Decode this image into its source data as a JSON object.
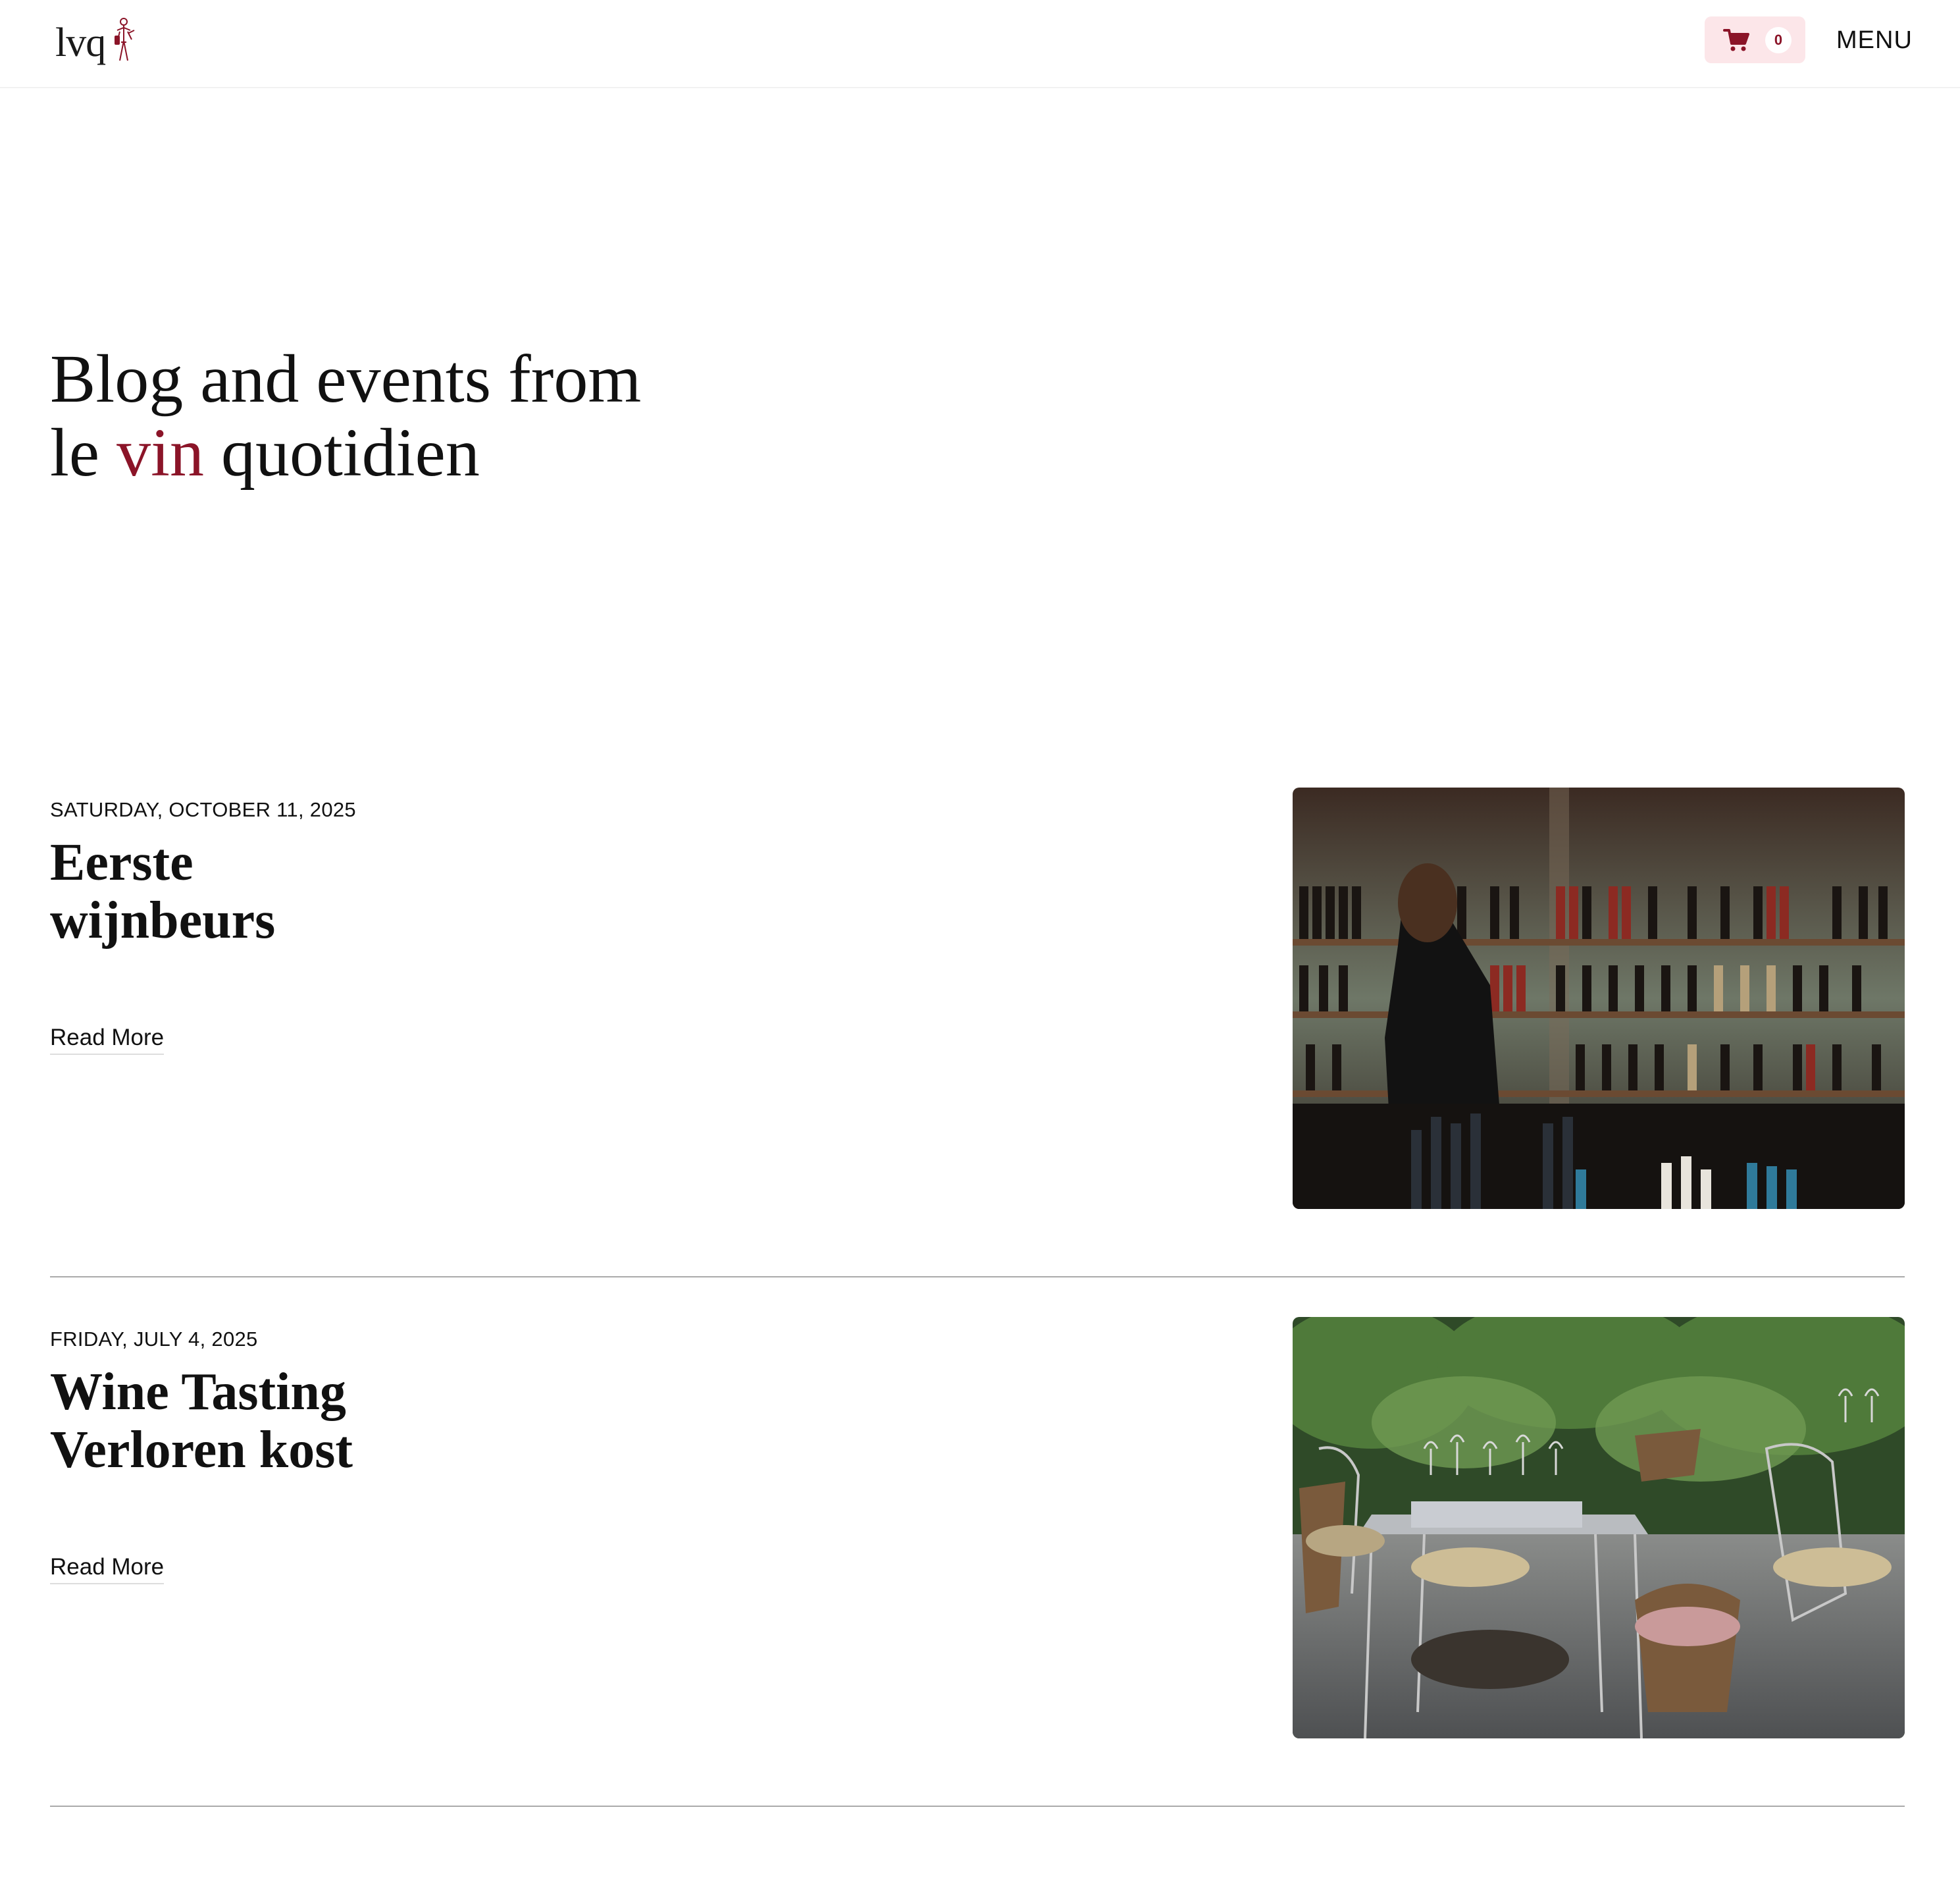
{
  "header": {
    "logo_text": "lvq",
    "cart_count": "0",
    "menu_label": "MENU",
    "accent_color": "#8b1428",
    "cart_bg_color": "#fce6e9"
  },
  "hero": {
    "line1": "Blog and events from",
    "line2_prefix": "le ",
    "line2_accent": "vin",
    "line2_suffix": " quotidien"
  },
  "posts": [
    {
      "date": "SATURDAY, OCTOBER 11, 2025",
      "title_line1": "Eerste",
      "title_line2": "wijnbeurs",
      "read_more": "Read More",
      "image_subject": "wine-shop-shelves-photo"
    },
    {
      "date": "FRIDAY, JULY 4, 2025",
      "title_line1": "Wine Tasting",
      "title_line2": "Verloren kost",
      "read_more": "Read More",
      "image_subject": "outdoor-terrace-tables-photo"
    }
  ]
}
